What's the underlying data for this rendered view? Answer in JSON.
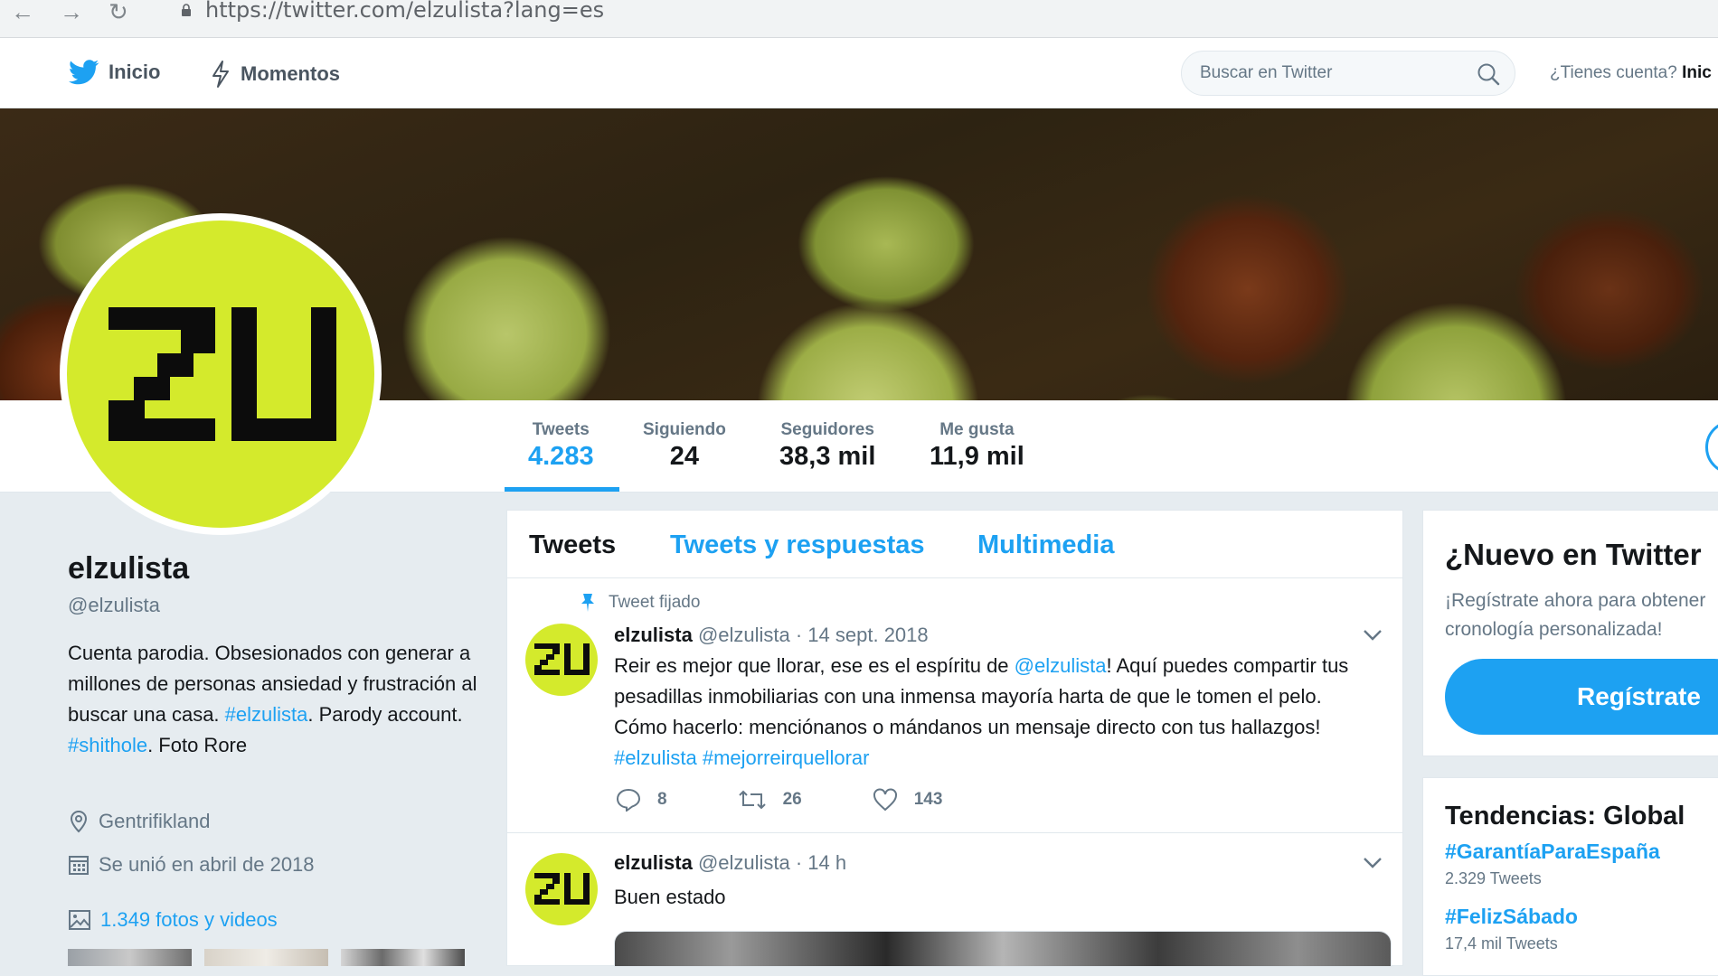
{
  "browser": {
    "url": "https://twitter.com/elzulista?lang=es"
  },
  "topnav": {
    "home_label": "Inicio",
    "moments_label": "Momentos",
    "search_placeholder": "Buscar en Twitter",
    "login_prompt": "¿Tienes cuenta?",
    "login_link": "Inic"
  },
  "profile": {
    "avatar_text": "ZU",
    "name": "elzulista",
    "handle": "@elzulista",
    "bio_text_1": "Cuenta parodia. Obsesionados con generar a millones de personas ansiedad y frustración al buscar una casa. ",
    "bio_link_1": "#elzulista",
    "bio_text_2": ". Parody account. ",
    "bio_link_2": "#shithole",
    "bio_text_3": ". Foto Rore",
    "location": "Gentrifikland",
    "joined": "Se unió en abril de 2018",
    "media_link": "1.349 fotos y videos"
  },
  "stats": [
    {
      "label": "Tweets",
      "value": "4.283"
    },
    {
      "label": "Siguiendo",
      "value": "24"
    },
    {
      "label": "Seguidores",
      "value": "38,3 mil"
    },
    {
      "label": "Me gusta",
      "value": "11,9 mil"
    }
  ],
  "timeline": {
    "tabs": [
      "Tweets",
      "Tweets y respuestas",
      "Multimedia"
    ],
    "tweets": [
      {
        "pinned_label": "Tweet fijado",
        "name": "elzulista",
        "handle_time": "@elzulista · 14 sept. 2018",
        "body_1": "Reir es mejor que llorar, ese es el espíritu de ",
        "mention": "@elzulista",
        "body_2": "! Aquí puedes compartir tus pesadillas inmobiliarias con una inmensa mayoría harta de que le tomen el pelo. Cómo hacerlo: menciónanos o mándanos un mensaje directo con tus hallazgos! ",
        "hashtags": "#elzulista #mejorreirquellorar",
        "replies": "8",
        "retweets": "26",
        "likes": "143"
      },
      {
        "name": "elzulista",
        "handle_time": "@elzulista · 14 h",
        "body": "Buen estado"
      }
    ]
  },
  "sidebar": {
    "signup_title": "¿Nuevo en Twitter",
    "signup_text_1": "¡Regístrate ahora para obtener",
    "signup_text_2": "cronología personalizada!",
    "signup_button": "Regístrate",
    "trends_title": "Tendencias: Global",
    "trends": [
      {
        "tag": "#GarantíaParaEspaña",
        "count": "2.329 Tweets"
      },
      {
        "tag": "#FelizSábado",
        "count": "17,4 mil Tweets"
      }
    ]
  },
  "colors": {
    "accent": "#1da1f2",
    "avatar_bg": "#d4ea2c",
    "background": "#e6ecf0"
  }
}
